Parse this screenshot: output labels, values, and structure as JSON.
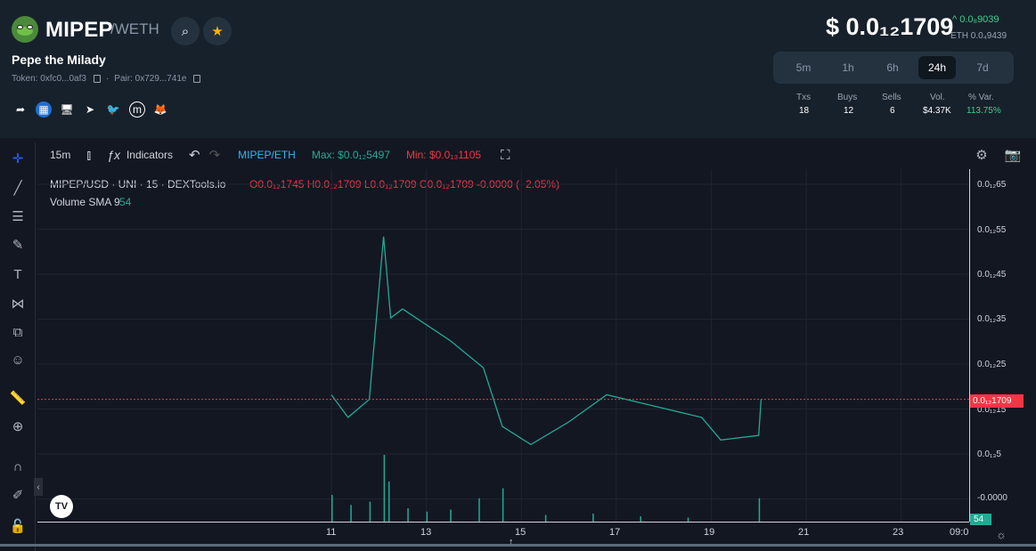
{
  "header": {
    "symbol": "MIPEP",
    "quote": "/WETH",
    "name": "Pepe the Milady",
    "token": "Token: 0xfc0...0af3",
    "pair": "Pair: 0x729...741e",
    "icons": [
      "binoculars-icon",
      "star-icon"
    ],
    "social": [
      "share-icon",
      "chart-icon",
      "website-icon",
      "telegram-icon",
      "twitter-icon",
      "coinmarketcap-icon",
      "metamask-icon"
    ]
  },
  "price": {
    "usd": "$ 0.0₁₂1709",
    "change": "^ 0.0₈9039",
    "eth": "ETH 0.0₄9439"
  },
  "timeframes": [
    "5m",
    "1h",
    "6h",
    "24h",
    "7d"
  ],
  "active_timeframe": "24h",
  "stats": [
    {
      "label": "Txs",
      "value": "18"
    },
    {
      "label": "Buys",
      "value": "12"
    },
    {
      "label": "Sells",
      "value": "6"
    },
    {
      "label": "Vol.",
      "value": "$4.37K"
    },
    {
      "label": "% Var.",
      "value": "113.75%"
    }
  ],
  "toolbar": {
    "interval": "15m",
    "indicators": "Indicators",
    "pair": "MIPEP/ETH",
    "max": "Max: $0.0₁₂5497",
    "min": "Min: $0.0₁₃1105"
  },
  "legend": {
    "title": "MIPEP/USD · UNI · 15 · DEXTools.io",
    "ohlc": "O0.0₁₂1745 H0.0₁₂1709 L0.0₁₂1709 C0.0₁₂1709 -0.0000 (−2.05%)",
    "volume": "Volume SMA 9",
    "volume_value": "54"
  },
  "price_axis": [
    "0.0₁₂65",
    "0.0₁₂55",
    "0.0₁₂45",
    "0.0₁₂35",
    "0.0₁₂25",
    "0.0₁₂15",
    "0.0₁₃5",
    "-0.0000"
  ],
  "current_price_label": "0.0₁₂1709",
  "volume_label": "54",
  "time_axis": [
    "11",
    "13",
    "15",
    "17",
    "19",
    "21",
    "23",
    "09:0"
  ],
  "chart_data": {
    "type": "line",
    "series": [
      {
        "values": [
          [
            11.0,
            0.19
          ],
          [
            11.35,
            0.14
          ],
          [
            11.8,
            0.18
          ],
          [
            12.1,
            0.54
          ],
          [
            12.25,
            0.36
          ],
          [
            12.5,
            0.38
          ],
          [
            13.5,
            0.31
          ],
          [
            14.2,
            0.25
          ],
          [
            14.6,
            0.12
          ],
          [
            15.2,
            0.08
          ],
          [
            16.0,
            0.13
          ],
          [
            16.8,
            0.19
          ],
          [
            18.0,
            0.16
          ],
          [
            18.8,
            0.14
          ],
          [
            19.2,
            0.09
          ],
          [
            20.0,
            0.1
          ],
          [
            20.05,
            0.18
          ]
        ]
      }
    ],
    "ylim": [
      0,
      0.65
    ],
    "xlim": [
      10,
      25
    ]
  }
}
